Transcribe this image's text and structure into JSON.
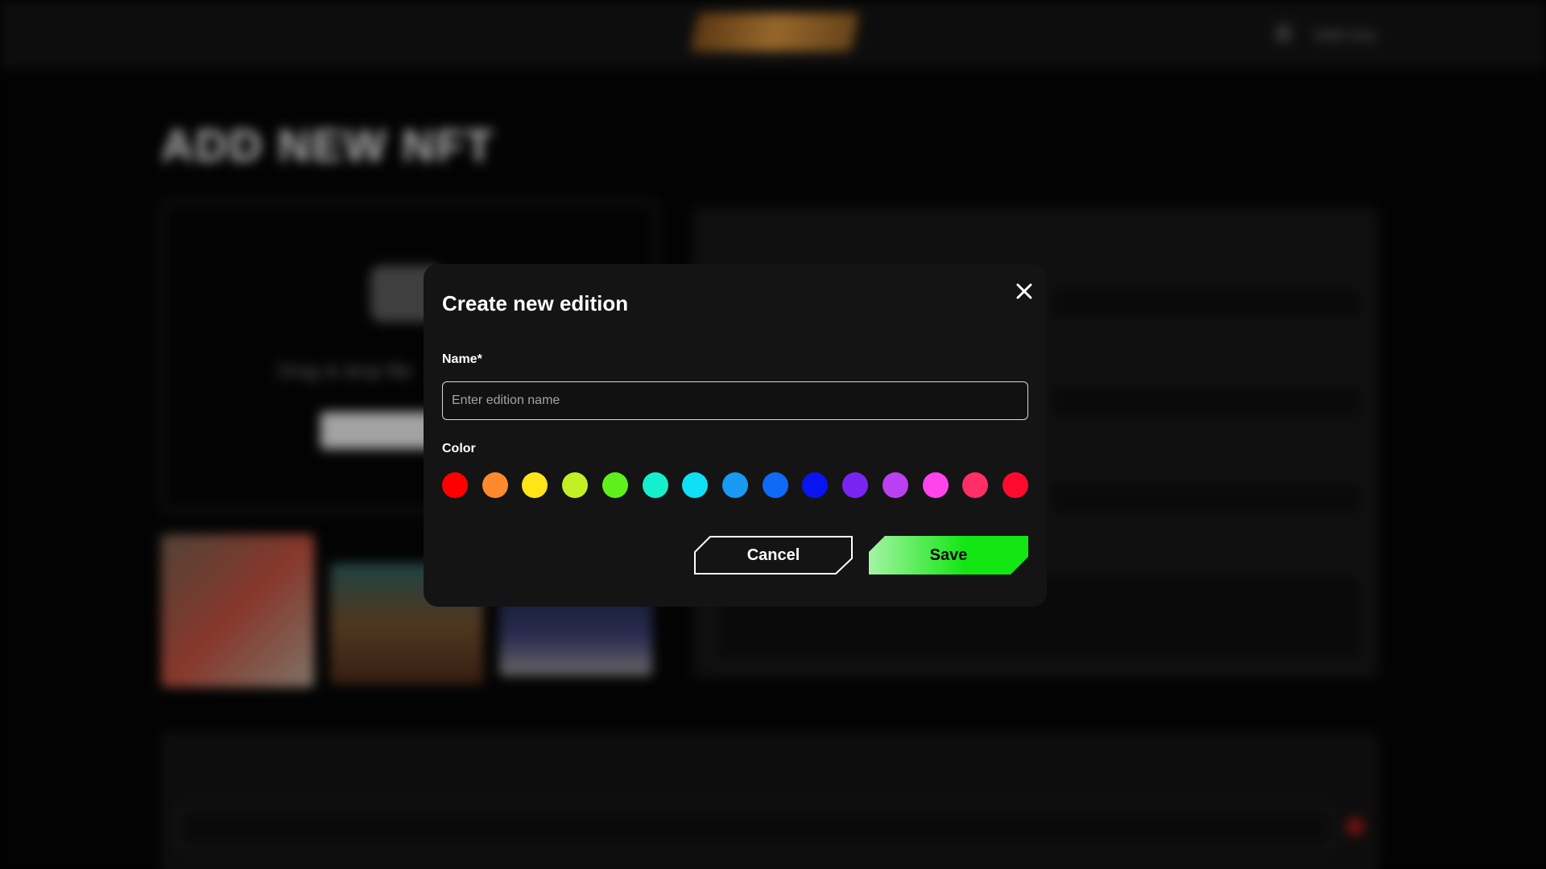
{
  "background": {
    "page_title": "ADD NEW NFT",
    "header_user": "DAN Cha",
    "dropzone_text": "Drag & drop file"
  },
  "modal": {
    "title": "Create new edition",
    "name_label": "Name*",
    "name_placeholder": "Enter edition name",
    "name_value": "",
    "color_label": "Color",
    "colors": [
      "#ff0000",
      "#ff8a2e",
      "#ffe41a",
      "#c2f024",
      "#5ef01a",
      "#14f0cc",
      "#10e0f4",
      "#1899f2",
      "#0f6af5",
      "#0a14f0",
      "#7a24f4",
      "#bb40f2",
      "#ff44ee",
      "#ff2e66",
      "#ff0a2e"
    ],
    "cancel_label": "Cancel",
    "save_label": "Save",
    "save_gradient": [
      "#a4f4a4",
      "#14e614"
    ]
  }
}
